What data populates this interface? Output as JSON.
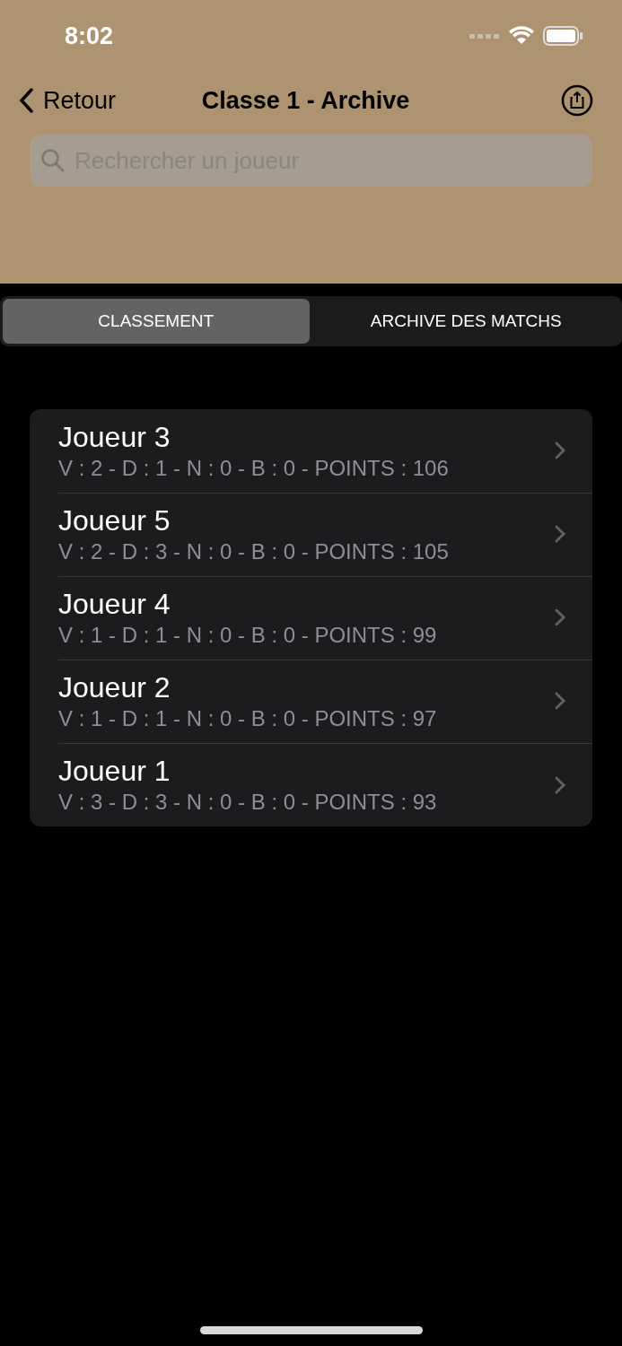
{
  "status_bar": {
    "time": "8:02"
  },
  "nav": {
    "back": "Retour",
    "title": "Classe 1 - Archive"
  },
  "search": {
    "placeholder": "Rechercher un joueur"
  },
  "segments": [
    {
      "label": "CLASSEMENT",
      "selected": true
    },
    {
      "label": "ARCHIVE DES MATCHS",
      "selected": false
    }
  ],
  "players": [
    {
      "name": "Joueur 3",
      "stats": "V : 2 - D : 1 - N : 0 - B : 0 - POINTS : 106"
    },
    {
      "name": "Joueur 5",
      "stats": "V : 2 - D : 3 - N : 0 - B : 0 - POINTS : 105"
    },
    {
      "name": "Joueur 4",
      "stats": "V : 1 - D : 1 - N : 0 - B : 0 - POINTS : 99"
    },
    {
      "name": "Joueur 2",
      "stats": "V : 1 - D : 1 - N : 0 - B : 0 - POINTS : 97"
    },
    {
      "name": "Joueur 1",
      "stats": "V : 3 - D : 3 - N : 0 - B : 0 - POINTS : 93"
    }
  ]
}
